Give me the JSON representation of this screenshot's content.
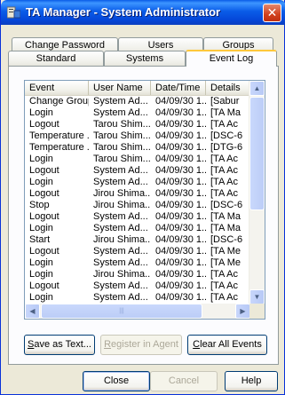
{
  "window": {
    "title": "TA Manager - System Administrator",
    "close_glyph": "✕"
  },
  "tabs": {
    "row_back": [
      "Change Password",
      "Users",
      "Groups"
    ],
    "row_front": [
      "Standard",
      "Systems",
      "Event Log"
    ],
    "active": "Event Log"
  },
  "event_list": {
    "columns": [
      "Event",
      "User Name",
      "Date/Time",
      "Details"
    ],
    "rows": [
      [
        "Change Group",
        "System Ad...",
        "04/09/30 1...",
        "[Sabur"
      ],
      [
        "Login",
        "System Ad...",
        "04/09/30 1...",
        "[TA Ma"
      ],
      [
        "Logout",
        "Tarou Shim...",
        "04/09/30 1...",
        "[TA Ac"
      ],
      [
        "Temperature ...",
        "Tarou Shim...",
        "04/09/30 1...",
        "[DSC-6"
      ],
      [
        "Temperature ...",
        "Tarou Shim...",
        "04/09/30 1...",
        "[DTG-6"
      ],
      [
        "Login",
        "Tarou Shim...",
        "04/09/30 1...",
        "[TA Ac"
      ],
      [
        "Logout",
        "System Ad...",
        "04/09/30 1...",
        "[TA Ac"
      ],
      [
        "Login",
        "System Ad...",
        "04/09/30 1...",
        "[TA Ac"
      ],
      [
        "Logout",
        "Jirou Shima...",
        "04/09/30 1...",
        "[TA Ac"
      ],
      [
        "Stop",
        "Jirou Shima...",
        "04/09/30 1...",
        "[DSC-6"
      ],
      [
        "Logout",
        "System Ad...",
        "04/09/30 1...",
        "[TA Ma"
      ],
      [
        "Login",
        "System Ad...",
        "04/09/30 1...",
        "[TA Ma"
      ],
      [
        "Start",
        "Jirou Shima...",
        "04/09/30 1...",
        "[DSC-6"
      ],
      [
        "Logout",
        "System Ad...",
        "04/09/30 1...",
        "[TA Me"
      ],
      [
        "Login",
        "System Ad...",
        "04/09/30 1...",
        "[TA Me"
      ],
      [
        "Login",
        "Jirou Shima...",
        "04/09/30 1...",
        "[TA Ac"
      ],
      [
        "Logout",
        "System Ad...",
        "04/09/30 1...",
        "[TA Ac"
      ],
      [
        "Login",
        "System Ad...",
        "04/09/30 1...",
        "[TA Ac"
      ],
      [
        "Logout",
        "System Ad...",
        "04/09/30 1...",
        "[TA Ac"
      ]
    ]
  },
  "scrollbar": {
    "up": "▲",
    "down": "▼",
    "left": "◀",
    "right": "▶",
    "grip": "|||"
  },
  "panel_buttons": {
    "save_text": {
      "pre": "",
      "accel": "S",
      "post": "ave as Text..."
    },
    "register_agent": {
      "pre": "",
      "accel": "R",
      "post": "egister in Agent"
    },
    "clear_events": {
      "pre": "",
      "accel": "C",
      "post": "lear All Events"
    }
  },
  "dialog_buttons": {
    "close": "Close",
    "cancel": "Cancel",
    "help": "Help"
  },
  "colors": {
    "titlebar": "#0a5ce8",
    "close_button": "#d1401c",
    "active_tab_accent": "#ffc83c"
  }
}
